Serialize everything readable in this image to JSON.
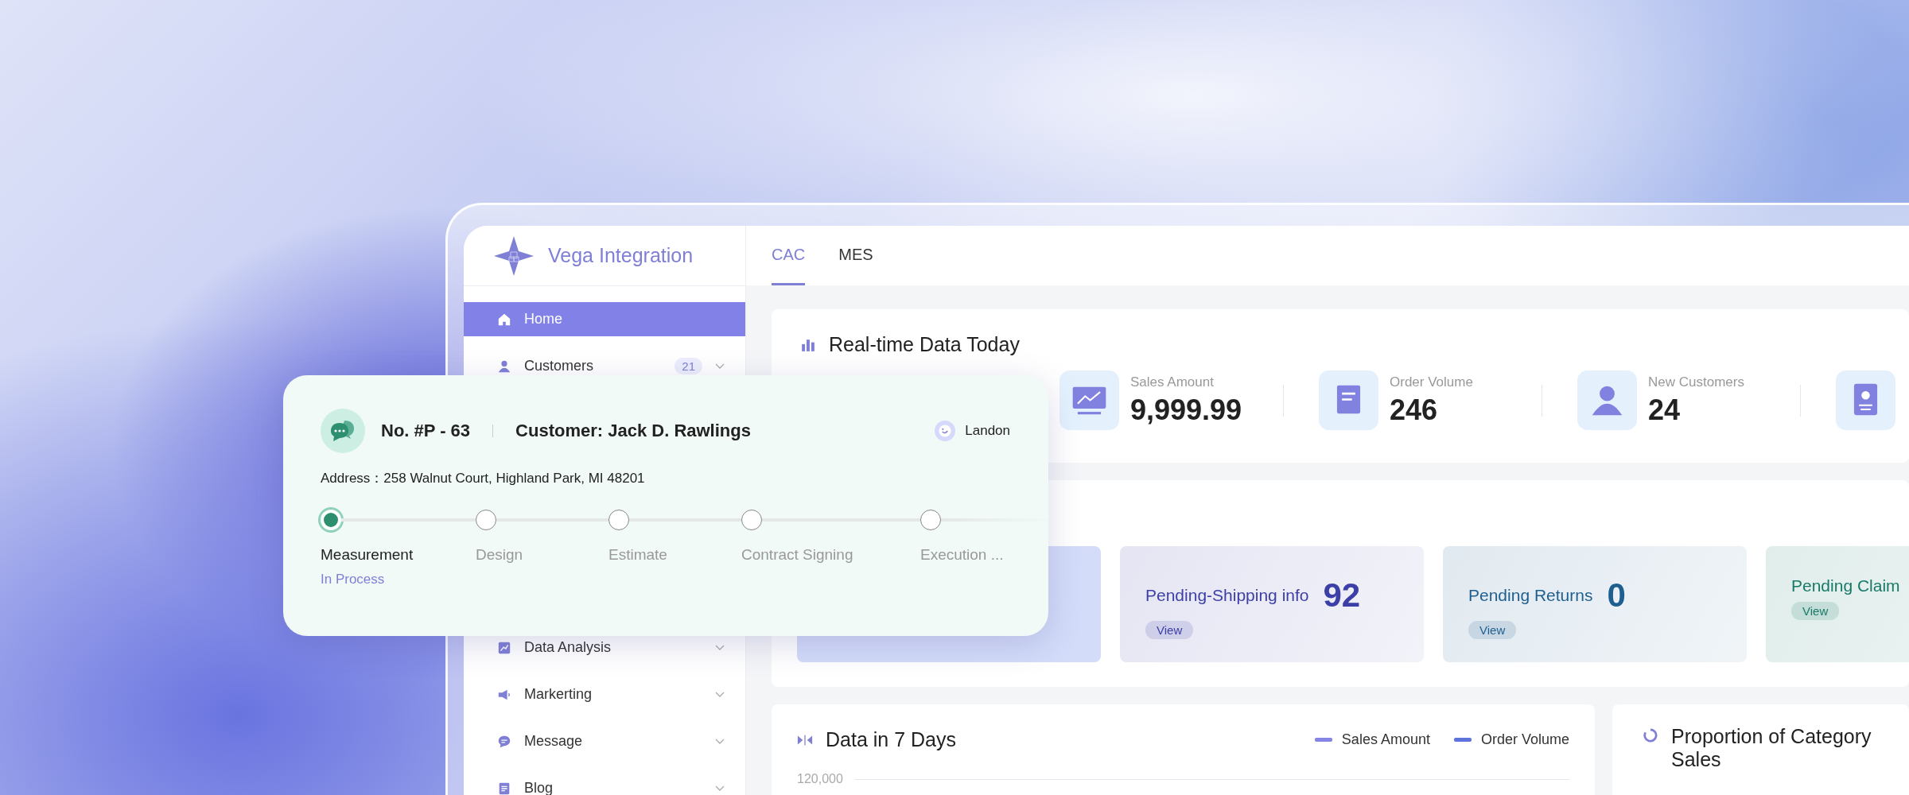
{
  "brand": {
    "name": "Vega Integration"
  },
  "tabs": [
    {
      "label": "CAC",
      "selected": true
    },
    {
      "label": "MES",
      "selected": false
    }
  ],
  "sidebar": {
    "items": [
      {
        "kind": "home",
        "label": "Home",
        "selected": true,
        "has_submenu": false
      },
      {
        "kind": "person",
        "label": "Customers",
        "badge": "21",
        "selected": false,
        "has_submenu": true
      },
      {
        "kind": "hidden"
      },
      {
        "kind": "hidden"
      },
      {
        "kind": "hidden"
      },
      {
        "kind": "hidden"
      },
      {
        "kind": "hidden"
      },
      {
        "kind": "chart",
        "label": "Data Analysis",
        "selected": false,
        "has_submenu": true
      },
      {
        "kind": "megaphone",
        "label": "Markerting",
        "selected": false,
        "has_submenu": true
      },
      {
        "kind": "chat",
        "label": "Message",
        "selected": false,
        "has_submenu": true
      },
      {
        "kind": "document",
        "label": "Blog",
        "selected": false,
        "has_submenu": true
      }
    ]
  },
  "realtime": {
    "title": "Real-time Data Today",
    "stats": [
      {
        "kind": "hidden"
      },
      {
        "kind": "chart",
        "label": "Sales Amount",
        "value": "9,999.99"
      },
      {
        "kind": "document",
        "label": "Order Volume",
        "value": "246"
      },
      {
        "kind": "person",
        "label": "New Customers",
        "value": "24"
      },
      {
        "kind": "badge"
      }
    ]
  },
  "pending": [
    {
      "kind": "hidden",
      "color": "#c9d3f7"
    },
    {
      "kind": "card",
      "title": "Pending-Shipping info",
      "count": "92",
      "action": "View",
      "color": "#3c3fa6"
    },
    {
      "kind": "card",
      "title": "Pending Returns",
      "count": "0",
      "action": "View",
      "color": "#1f5f8f"
    },
    {
      "kind": "card",
      "title": "Pending Claim",
      "action": "View",
      "color": "#177a68"
    }
  ],
  "data_7_days": {
    "title": "Data in 7 Days",
    "legend": [
      {
        "label": "Sales Amount",
        "color": "#8585e8"
      },
      {
        "label": "Order Volume",
        "color": "#5d72dc"
      }
    ],
    "y_tick_label": "120,000"
  },
  "proportion": {
    "title": "Proportion of Category Sales"
  },
  "order_card": {
    "number": "No. #P - 63",
    "customer": "Customer: Jack D. Rawlings",
    "assignee": "Landon",
    "address": "Address：258 Walnut Court, Highland Park, MI 48201",
    "steps": [
      {
        "label": "Measurement",
        "current": true,
        "status": "In Process"
      },
      {
        "label": "Design",
        "current": false
      },
      {
        "label": "Estimate",
        "current": false
      },
      {
        "label": "Contract Signing",
        "current": false
      },
      {
        "label": "Execution ...",
        "current": false
      }
    ]
  }
}
